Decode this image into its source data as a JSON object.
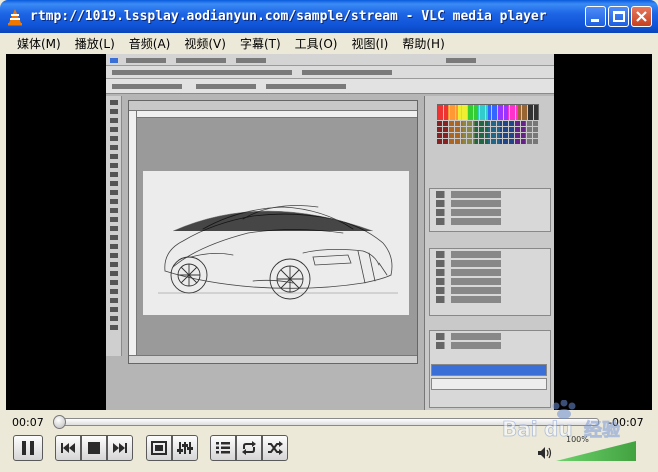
{
  "window": {
    "title": "rtmp://1019.lssplay.aodianyun.com/sample/stream - VLC media player"
  },
  "menu": [
    "媒体(M)",
    "播放(L)",
    "音频(A)",
    "视频(V)",
    "字幕(T)",
    "工具(O)",
    "视图(I)",
    "帮助(H)"
  ],
  "player": {
    "elapsed": "00:07",
    "remaining": "-00:07",
    "volume_percent": 100,
    "volume_label": "100%"
  },
  "icons": {
    "pause": "pause-icon",
    "prev": "previous-icon",
    "stop": "stop-icon",
    "next": "next-icon",
    "fullscreen": "fullscreen-icon",
    "extended": "equalizer-icon",
    "playlist": "playlist-icon",
    "loop": "loop-icon",
    "shuffle": "shuffle-icon",
    "volume": "speaker-icon"
  },
  "colors": {
    "titlebar": "#1e66e6",
    "vlc_orange": "#f07800",
    "volume_green": "#3fb03f"
  }
}
